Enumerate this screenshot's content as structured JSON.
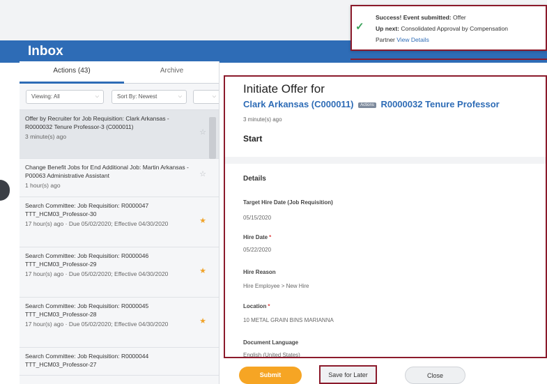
{
  "inbox": {
    "title": "Inbox"
  },
  "tabs": {
    "actions": "Actions (43)",
    "archive": "Archive"
  },
  "filters": {
    "viewing": "Viewing: All",
    "sort": "Sort By: Newest"
  },
  "items": [
    {
      "title": "Offer by Recruiter for Job Requisition: Clark Arkansas - R0000032 Tenure Professor-3 (C000011)",
      "time": "3 minute(s) ago",
      "starred": false
    },
    {
      "title": "Change Benefit Jobs for End Additional Job: Martin Arkansas - P00063 Administrative Assistant",
      "time": "1 hour(s) ago",
      "starred": false
    },
    {
      "title": "Search Committee: Job Requisition: R0000047 TTT_HCM03_Professor-30",
      "time": "17 hour(s) ago · Due 05/02/2020; Effective 04/30/2020",
      "starred": true
    },
    {
      "title": "Search Committee: Job Requisition: R0000046 TTT_HCM03_Professor-29",
      "time": "17 hour(s) ago · Due 05/02/2020; Effective 04/30/2020",
      "starred": true
    },
    {
      "title": "Search Committee: Job Requisition: R0000045 TTT_HCM03_Professor-28",
      "time": "17 hour(s) ago · Due 05/02/2020; Effective 04/30/2020",
      "starred": true
    },
    {
      "title": "Search Committee: Job Requisition: R0000044 TTT_HCM03_Professor-27",
      "time": "",
      "starred": false
    }
  ],
  "detail": {
    "title": "Initiate Offer for",
    "worker": "Clark Arkansas (C000011)",
    "actions_label": "Actions",
    "requisition": "R0000032 Tenure Professor",
    "ago": "3 minute(s) ago",
    "start": "Start",
    "details": "Details",
    "fields": [
      {
        "label": "Target Hire Date (Job Requisition)",
        "value": "05/15/2020",
        "required": false
      },
      {
        "label": "Hire Date",
        "value": "05/22/2020",
        "required": true
      },
      {
        "label": "Hire Reason",
        "value": "Hire Employee > New Hire",
        "required": false
      },
      {
        "label": "Location",
        "value": "10 METAL GRAIN BINS MARIANNA",
        "required": true
      },
      {
        "label": "Document Language",
        "value": "English (United States)",
        "required": false
      }
    ]
  },
  "toast": {
    "success_label": "Success! Event submitted:",
    "success_value": "Offer",
    "upnext_label": "Up next:",
    "upnext_value": "Consolidated Approval by Compensation",
    "partner": "Partner",
    "view_details": "View Details"
  },
  "buttons": {
    "submit": "Submit",
    "save": "Save for Later",
    "close": "Close"
  },
  "colors": {
    "brand_blue": "#2e6cb6",
    "highlight_red": "#8b1a2b",
    "submit_orange": "#f6a524",
    "star": "#f0a32a"
  }
}
